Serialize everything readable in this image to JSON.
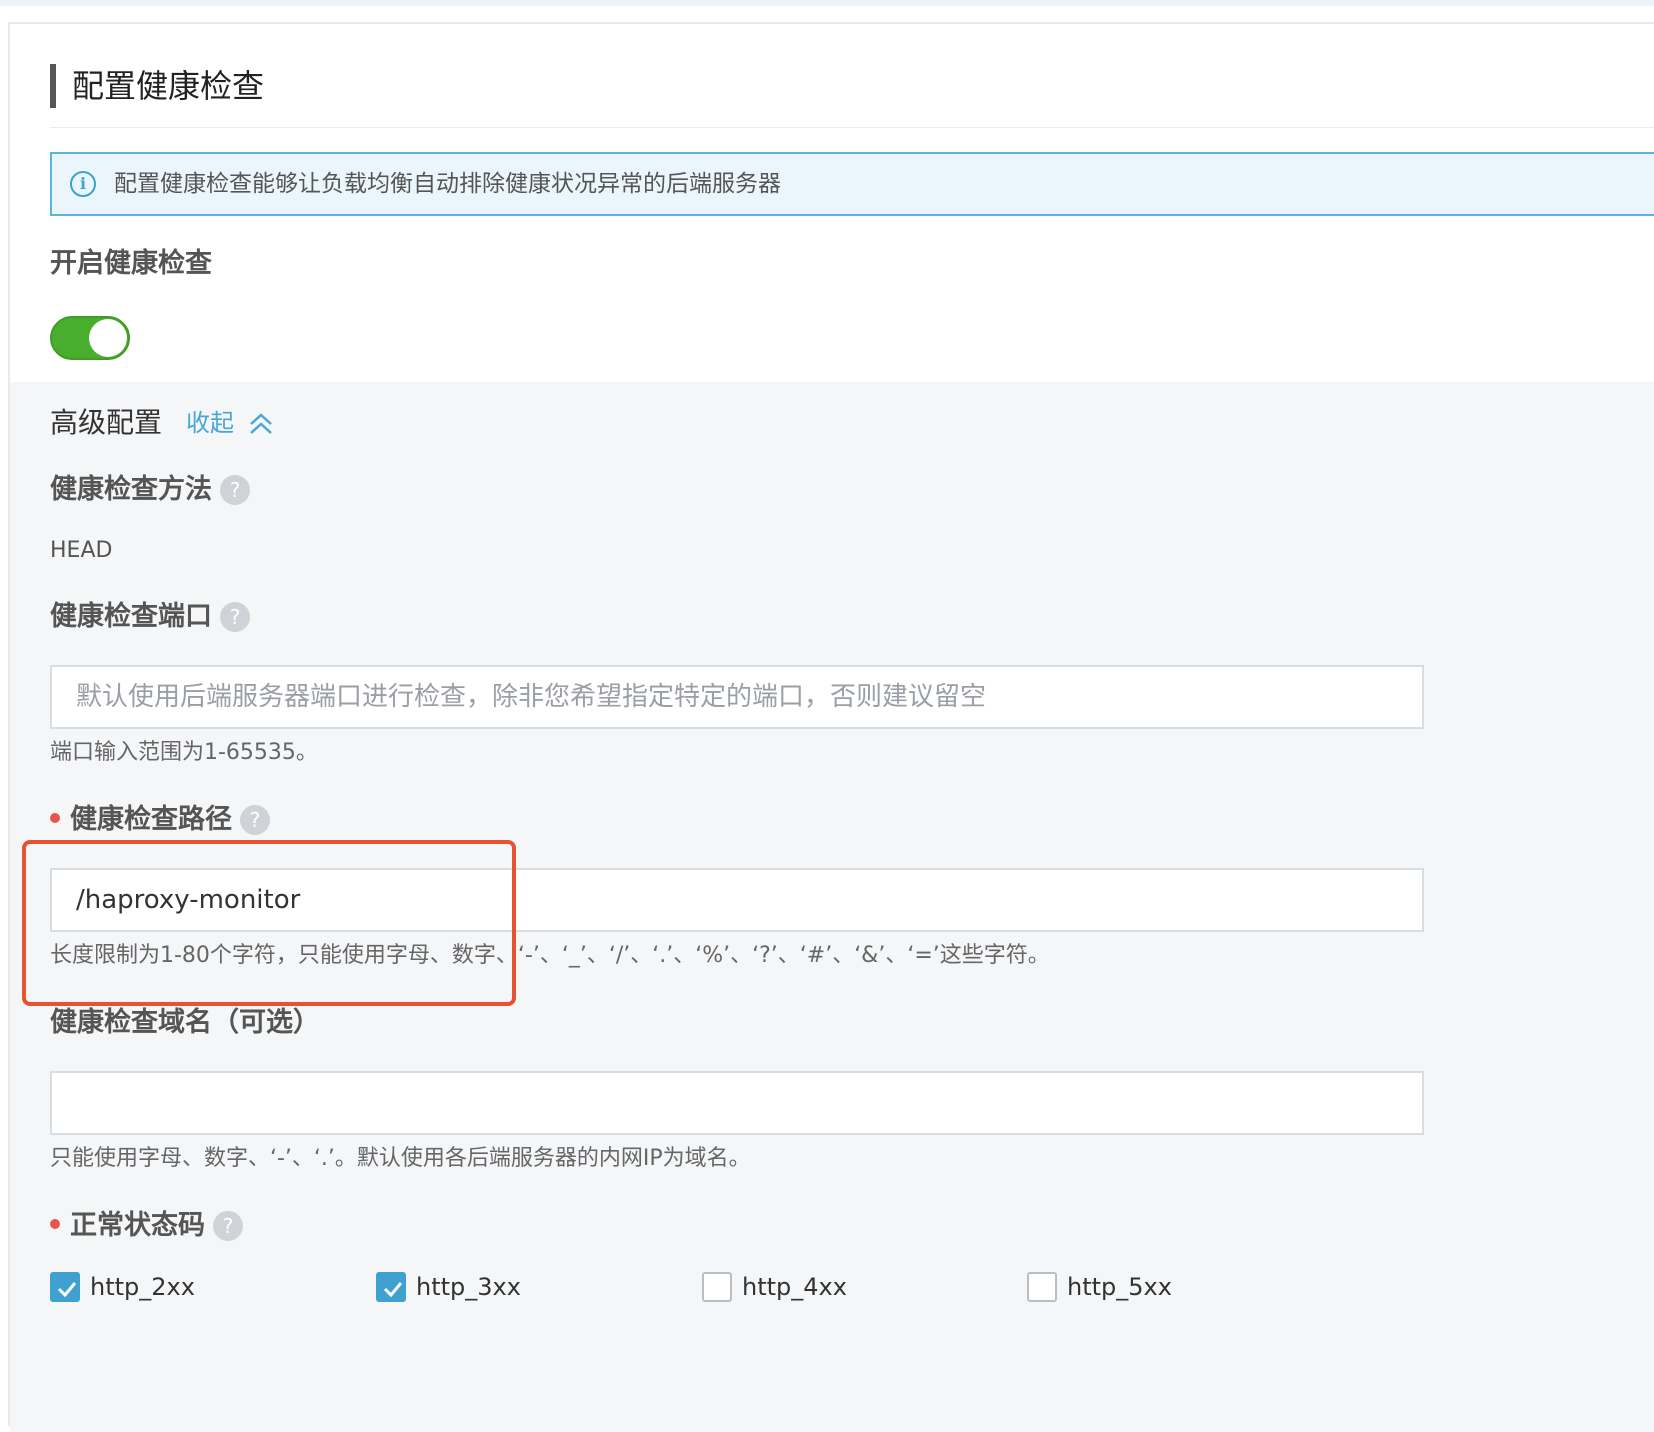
{
  "section": {
    "title": "配置健康检查",
    "info": "配置健康检查能够让负载均衡自动排除健康状况异常的后端服务器",
    "enable_label": "开启健康检查",
    "enable_on": true
  },
  "advanced": {
    "title": "高级配置",
    "collapse_label": "收起",
    "method": {
      "label": "健康检查方法",
      "value": "HEAD"
    },
    "port": {
      "label": "健康检查端口",
      "placeholder": "默认使用后端服务器端口进行检查，除非您希望指定特定的端口，否则建议留空",
      "hint": "端口输入范围为1-65535。"
    },
    "path": {
      "label": "健康检查路径",
      "value": "/haproxy-monitor",
      "hint": "长度限制为1-80个字符，只能使用字母、数字、‘-’、‘_’、‘/’、‘.’、‘%’、‘?’、‘#’、‘&’、‘=’这些字符。"
    },
    "domain": {
      "label": "健康检查域名（可选）",
      "value": "",
      "hint": "只能使用字母、数字、‘-’、‘.’。默认使用各后端服务器的内网IP为域名。"
    },
    "status_codes": {
      "label": "正常状态码",
      "options": [
        {
          "label": "http_2xx",
          "checked": true
        },
        {
          "label": "http_3xx",
          "checked": true
        },
        {
          "label": "http_4xx",
          "checked": false
        },
        {
          "label": "http_5xx",
          "checked": false
        }
      ]
    }
  },
  "colors": {
    "accent": "#3ea1d0",
    "toggle_on": "#49ad2d",
    "required": "#e8574a",
    "highlight": "#e55331"
  }
}
